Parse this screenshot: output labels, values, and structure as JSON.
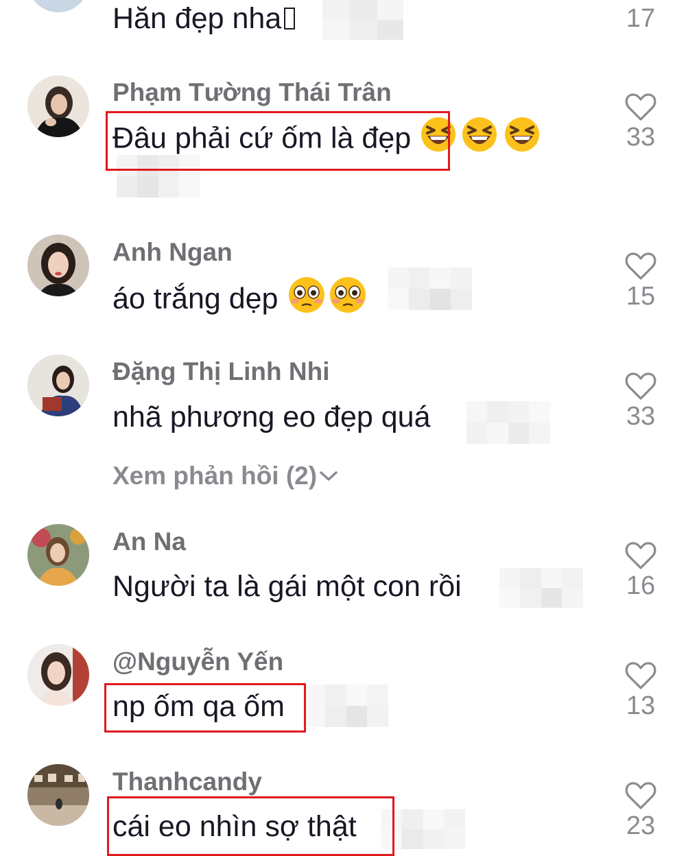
{
  "comments": [
    {
      "username": "",
      "text": "Hăn đẹp nha",
      "likes": "17",
      "highlighted": false,
      "partial": true
    },
    {
      "username": "Phạm Tường Thái Trân",
      "text": "Đâu phải cứ ốm là đẹp",
      "emoji": [
        "laughing-emoji",
        "laughing-emoji",
        "laughing-emoji"
      ],
      "likes": "33",
      "highlighted": true
    },
    {
      "username": "Anh Ngan",
      "text": "áo trắng dẹp",
      "emoji": [
        "flushed-emoji",
        "flushed-emoji"
      ],
      "likes": "15",
      "highlighted": false
    },
    {
      "username": "Đặng Thị Linh Nhi",
      "text": "nhã phương eo đẹp quá",
      "likes": "33",
      "highlighted": false,
      "replies_label": "Xem phản hồi (2)"
    },
    {
      "username": "An Na",
      "text": "Người ta là gái một con rồi",
      "likes": "16",
      "highlighted": false
    },
    {
      "username": "@Nguyễn Yến",
      "text": "np ốm qa ốm",
      "likes": "13",
      "highlighted": true
    },
    {
      "username": "Thanhcandy",
      "text": "cái eo nhìn sợ thật",
      "likes": "23",
      "highlighted": true
    }
  ],
  "colors": {
    "highlight_box": "#e0181e",
    "username": "#6f6f74",
    "comment_text": "#161823",
    "like_count": "#8a8b91"
  }
}
